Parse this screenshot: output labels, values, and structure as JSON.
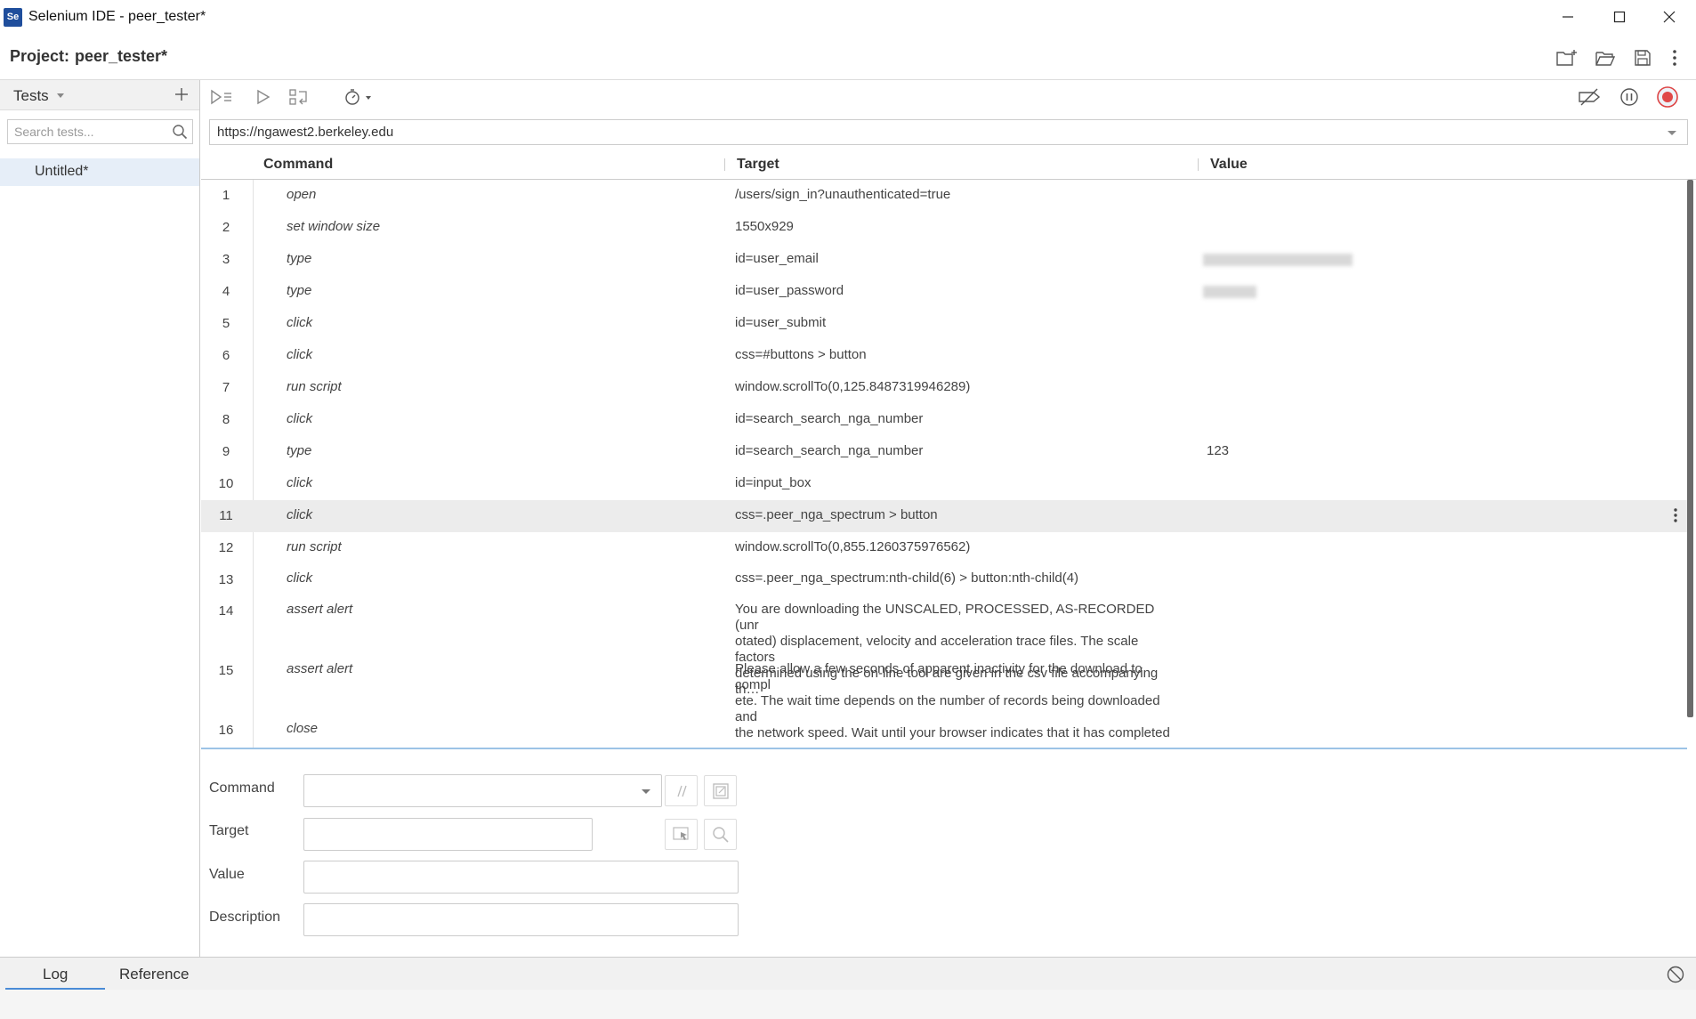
{
  "window": {
    "title": "Selenium IDE - peer_tester*",
    "logo_text": "Se"
  },
  "project": {
    "label": "Project:",
    "name": "peer_tester*"
  },
  "tests_panel": {
    "title": "Tests",
    "search_placeholder": "Search tests...",
    "tests": [
      {
        "label": "Untitled*",
        "selected": true
      }
    ]
  },
  "url_bar": {
    "value": "https://ngawest2.berkeley.edu"
  },
  "table": {
    "headers": {
      "command": "Command",
      "target": "Target",
      "value": "Value"
    },
    "rows": [
      {
        "num": "1",
        "command": "open",
        "target": "/users/sign_in?unauthenticated=true",
        "value": ""
      },
      {
        "num": "2",
        "command": "set window size",
        "target": "1550x929",
        "value": ""
      },
      {
        "num": "3",
        "command": "type",
        "target": "id=user_email",
        "value": ""
      },
      {
        "num": "4",
        "command": "type",
        "target": "id=user_password",
        "value": ""
      },
      {
        "num": "5",
        "command": "click",
        "target": "id=user_submit",
        "value": ""
      },
      {
        "num": "6",
        "command": "click",
        "target": "css=#buttons > button",
        "value": ""
      },
      {
        "num": "7",
        "command": "run script",
        "target": "window.scrollTo(0,125.8487319946289)",
        "value": ""
      },
      {
        "num": "8",
        "command": "click",
        "target": "id=search_search_nga_number",
        "value": ""
      },
      {
        "num": "9",
        "command": "type",
        "target": "id=search_search_nga_number",
        "value": "123"
      },
      {
        "num": "10",
        "command": "click",
        "target": "id=input_box",
        "value": ""
      },
      {
        "num": "11",
        "command": "click",
        "target": "css=.peer_nga_spectrum > button",
        "value": ""
      },
      {
        "num": "12",
        "command": "run script",
        "target": "window.scrollTo(0,855.1260375976562)",
        "value": ""
      },
      {
        "num": "13",
        "command": "click",
        "target": "css=.peer_nga_spectrum:nth-child(6) > button:nth-child(4)",
        "value": ""
      },
      {
        "num": "14",
        "command": "assert alert",
        "target_lines": [
          "You are downloading the UNSCALED, PROCESSED, AS-RECORDED (unr",
          "otated) displacement, velocity and acceleration trace files. The scale factors",
          "determined using the on-line tool are given in the csv file accompanying th…"
        ],
        "value": ""
      },
      {
        "num": "15",
        "command": "assert alert",
        "target_lines": [
          "Please allow a few seconds of apparent inactivity for the download to compl",
          "ete. The wait time depends on the number of records being downloaded and",
          "the network speed. Wait until your browser indicates that it has completed …"
        ],
        "value": ""
      },
      {
        "num": "16",
        "command": "close",
        "target": "",
        "value": ""
      }
    ]
  },
  "editor": {
    "command_label": "Command",
    "target_label": "Target",
    "value_label": "Value",
    "description_label": "Description",
    "command_value": "",
    "target_value": "",
    "value_value": "",
    "description_value": ""
  },
  "log_panel": {
    "tabs": [
      "Log",
      "Reference"
    ],
    "active_tab": "Log"
  }
}
